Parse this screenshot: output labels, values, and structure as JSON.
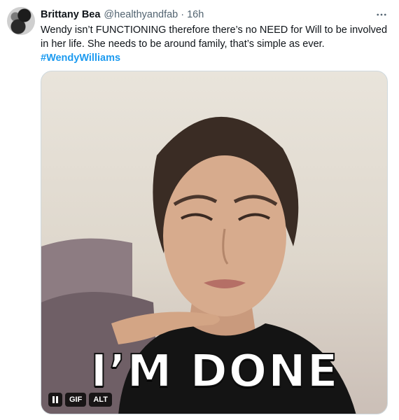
{
  "tweet": {
    "author_name": "Brittany Bea",
    "handle": "@healthyandfab",
    "separator": "·",
    "time": "16h",
    "text_lines": [
      "Wendy isn’t FUNCTIONING therefore there’s no NEED for Will to be involved",
      "in her life. She needs to be around family, that’s simple as ever."
    ],
    "hashtag": "#WendyWilliams"
  },
  "media": {
    "caption": "I’M DONE",
    "gif_label": "GIF",
    "alt_label": "ALT"
  },
  "icons": {
    "more": "more-options-icon",
    "pause": "pause-icon"
  },
  "colors": {
    "link": "#1d9bf0",
    "secondary_text": "#536471",
    "primary_text": "#0f1419"
  }
}
